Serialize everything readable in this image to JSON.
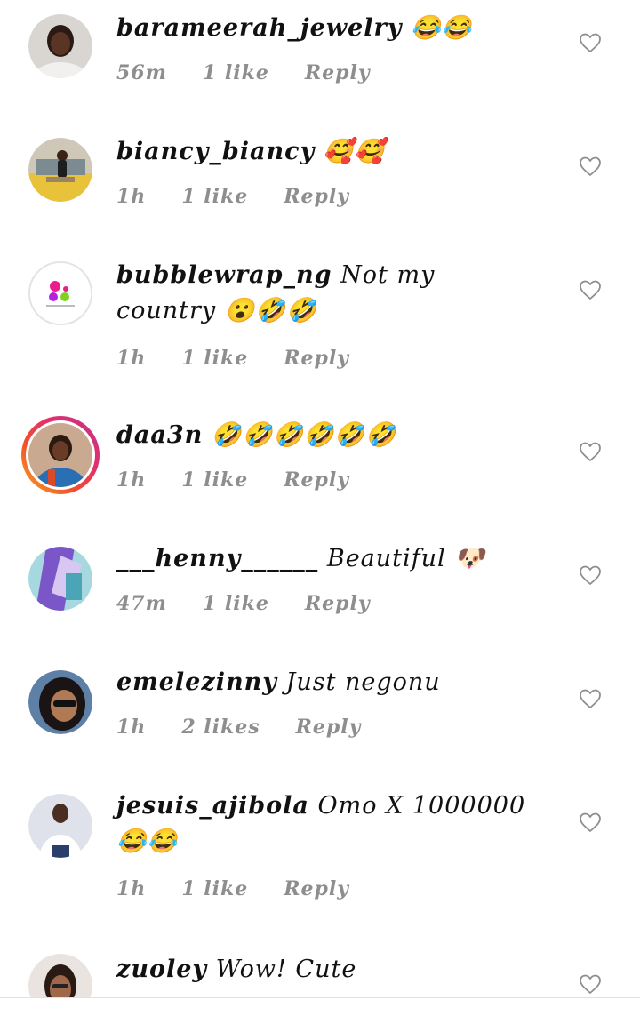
{
  "comments": [
    {
      "username": "barameerah_jewelry",
      "text": "😂😂",
      "time": "56m",
      "likes": "1 like",
      "reply": "Reply"
    },
    {
      "username": "biancy_biancy",
      "text": "🥰🥰",
      "time": "1h",
      "likes": "1 like",
      "reply": "Reply"
    },
    {
      "username": "bubblewrap_ng",
      "text": "Not my country 😮🤣🤣",
      "time": "1h",
      "likes": "1 like",
      "reply": "Reply"
    },
    {
      "username": "daa3n",
      "text": "🤣🤣🤣🤣🤣🤣",
      "time": "1h",
      "likes": "1 like",
      "reply": "Reply"
    },
    {
      "username": "___henny______",
      "text": "Beautiful 🐶",
      "time": "47m",
      "likes": "1 like",
      "reply": "Reply"
    },
    {
      "username": "emelezinny",
      "text": "Just negonu",
      "time": "1h",
      "likes": "2 likes",
      "reply": "Reply"
    },
    {
      "username": "jesuis_ajibola",
      "text": "Omo X 1000000 😂😂",
      "time": "1h",
      "likes": "1 like",
      "reply": "Reply"
    },
    {
      "username": "zuoley",
      "text": "Wow! Cute",
      "time": "",
      "likes": "",
      "reply": ""
    }
  ],
  "icons": {
    "like": "heart-outline-icon"
  },
  "colors": {
    "meta_text": "#8e8e8e",
    "story_ring_start": "#f9a825",
    "story_ring_end": "#c13584"
  }
}
